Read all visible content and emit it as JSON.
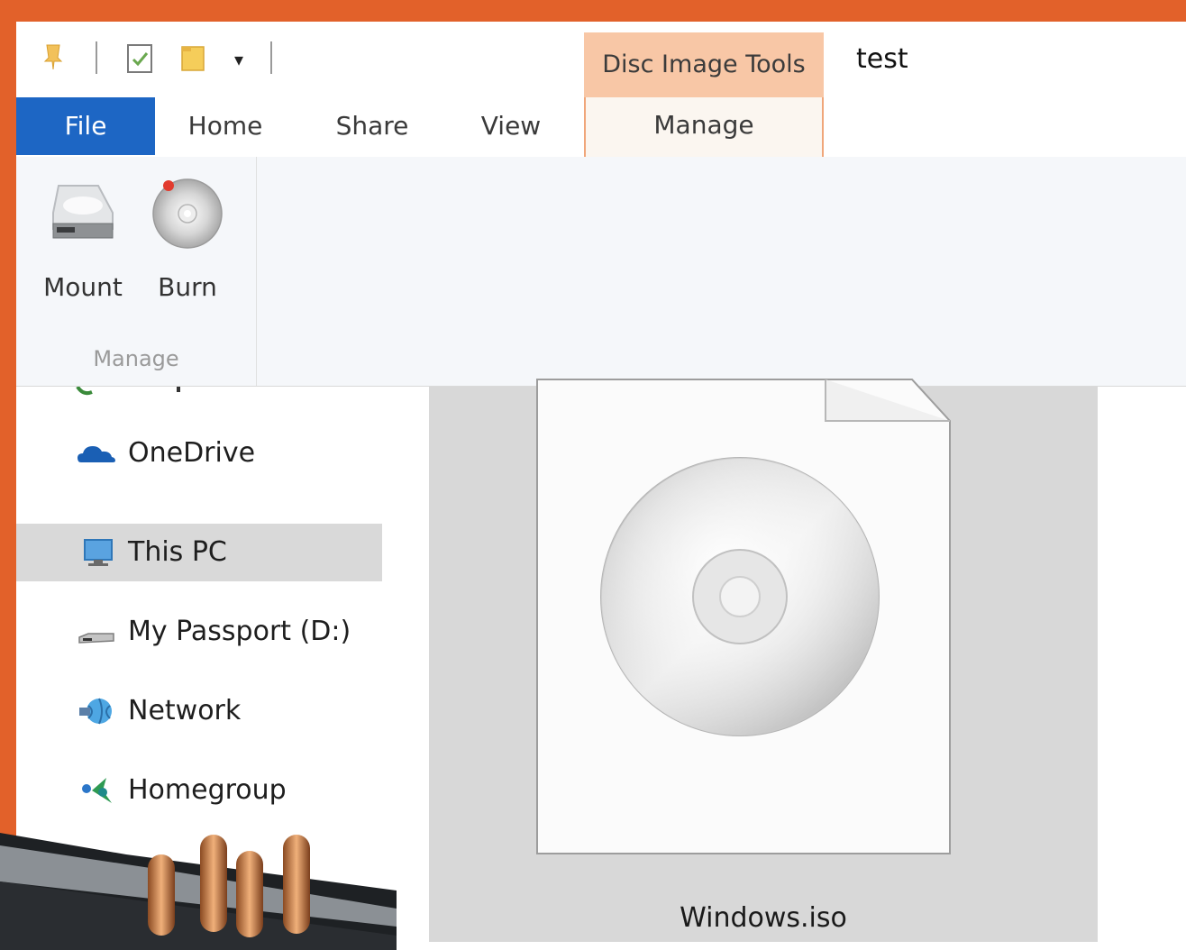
{
  "window": {
    "title": "test"
  },
  "ribbon_context": {
    "label": "Disc Image Tools"
  },
  "tabs": [
    {
      "label": "File"
    },
    {
      "label": "Home"
    },
    {
      "label": "Share"
    },
    {
      "label": "View"
    },
    {
      "label": "Manage"
    }
  ],
  "ribbon": {
    "buttons": [
      {
        "label": "Mount",
        "icon": "drive-icon"
      },
      {
        "label": "Burn",
        "icon": "disc-burn-icon"
      }
    ],
    "group_label": "Manage"
  },
  "nav": {
    "items": [
      {
        "label": "OneDrive",
        "icon": "onedrive-icon",
        "selected": false
      },
      {
        "label": "This PC",
        "icon": "this-pc-icon",
        "selected": true
      },
      {
        "label": "My Passport (D:)",
        "icon": "external-drive-icon",
        "selected": false
      },
      {
        "label": "Network",
        "icon": "network-icon",
        "selected": false
      },
      {
        "label": "Homegroup",
        "icon": "homegroup-icon",
        "selected": false
      }
    ]
  },
  "content": {
    "file": {
      "name": "Windows.iso",
      "icon": "disc-image-icon"
    }
  },
  "colors": {
    "frame": "#e2612a",
    "file_tab": "#1d66c4",
    "context_tab": "#f8c7a6",
    "selection": "#d9d9d9"
  }
}
